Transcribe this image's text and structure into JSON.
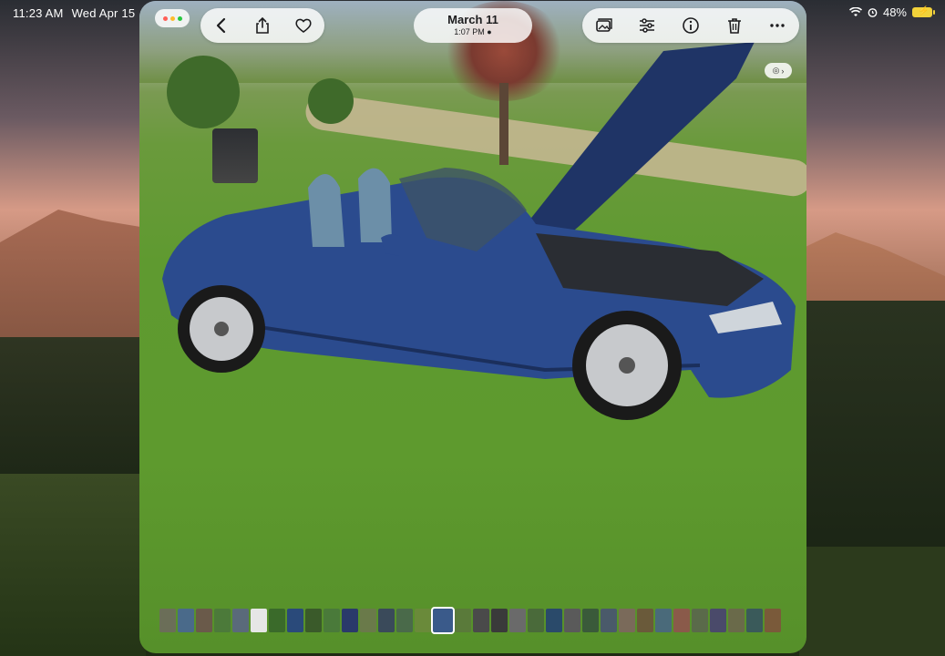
{
  "status_bar": {
    "time": "11:23 AM",
    "date": "Wed Apr 15",
    "battery": "48%"
  },
  "photo": {
    "date": "March 11",
    "time": "1:07 PM"
  },
  "toolbar_left": {
    "icons": [
      "chevron-left-icon",
      "share-icon",
      "heart-icon"
    ]
  },
  "toolbar_right": {
    "icons": [
      "photo-enhance-icon",
      "adjust-sliders-icon",
      "info-icon",
      "trash-icon",
      "more-icon"
    ]
  },
  "window_controls": {
    "colors": [
      "#ff5f57",
      "#febc2e",
      "#28c840"
    ]
  },
  "filmstrip": {
    "colors": [
      "#6b6e58",
      "#4a6a8a",
      "#6a5a4a",
      "#4c7a3a",
      "#5a6a7a",
      "#e6e6e6",
      "#3a6a2a",
      "#2a4a7a",
      "#3a5a2a",
      "#4a7a3a",
      "#2a3a6a",
      "#6a7a4a",
      "#3a4a5a",
      "#4a6a4a",
      "#6a8a3a",
      "#3a5a8a",
      "#5a7a3a",
      "#4a4a4a",
      "#3a3a3a",
      "#6a6a6a",
      "#4a6a3a",
      "#2a4a6a",
      "#5a5a5a",
      "#3a5a3a",
      "#4a5a6a",
      "#7a6a5a",
      "#6a5a3a",
      "#4a6a7a",
      "#8a5a4a",
      "#5a6a4a",
      "#4a4a6a",
      "#6a6a4a",
      "#3a5a5a",
      "#7a5a3a"
    ],
    "current_index": 15
  }
}
